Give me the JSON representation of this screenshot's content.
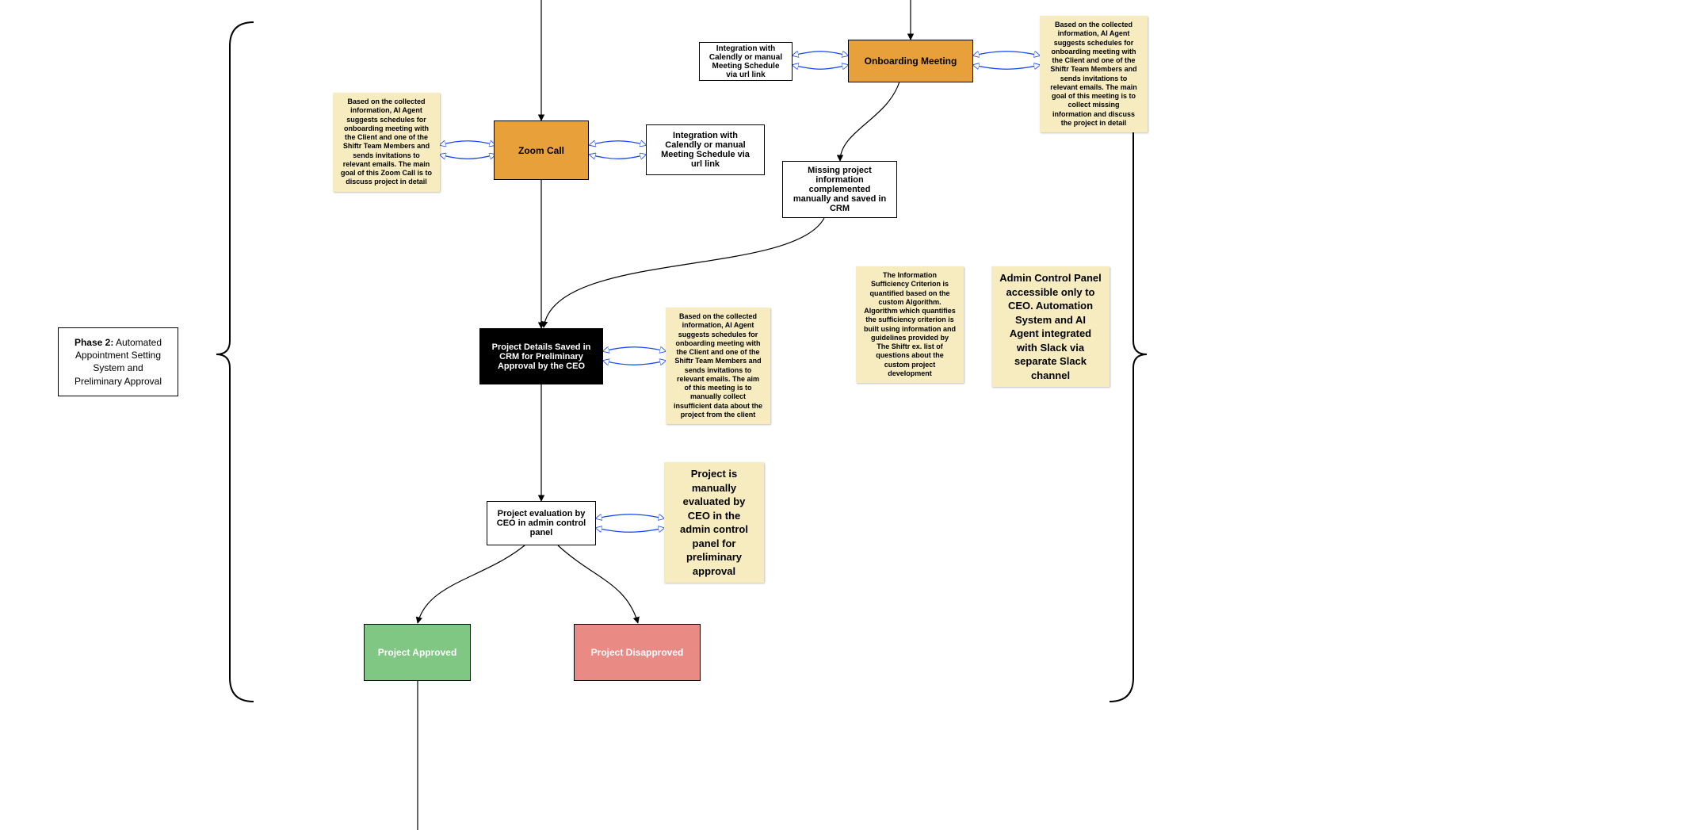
{
  "phase": {
    "label_html": "<strong>Phase 2:</strong> Automated Appointment Setting System and Preliminary Approval"
  },
  "nodes": {
    "zoom": "Zoom Call",
    "calendly_left": "Integration with Calendly or manual Meeting Schedule via url link",
    "calendly_right": "Integration with Calendly or manual Meeting Schedule via url link",
    "onboarding": "Onboarding Meeting",
    "missing": "Missing project information complemented manually and saved in CRM",
    "crm": "Project Details Saved in CRM for Preliminary Approval by the CEO",
    "ceo_eval": "Project evaluation by CEO in admin control panel",
    "approved": "Project Approved",
    "disapproved": "Project Disapproved"
  },
  "notes": {
    "zoom_note": "Based on the collected information, AI Agent suggests schedules for onboarding meeting with the Client and one of the Shiftr Team Members and sends invitations to relevant emails. The main goal of this Zoom Call is to discuss project in detail",
    "onboarding_note": "Based on the collected information, AI Agent suggests schedules for onboarding meeting with the Client and one of the Shiftr Team Members and sends invitations to relevant emails. The main goal of this meeting is to collect  missing information and discuss the project in detail",
    "crm_note": "Based on the collected information, AI Agent suggests schedules for onboarding meeting with the Client and one of the Shiftr Team Members and sends invitations to relevant emails. The aim of this meeting is to manually collect insufficient data about the project from the client",
    "criterion_note": "The Information Sufficiency Criterion is quantified based on the custom Algorithm. Algorithm which quantifies the sufficiency criterion is built using information and guidelines provided by The Shiftr ex. list of questions about the custom project development",
    "admin_note": "Admin Control Panel accessible only to CEO. Automation System and AI Agent integrated with Slack via separate Slack channel",
    "eval_note": "Project is manually evaluated by CEO in the admin control panel for preliminary approval"
  }
}
